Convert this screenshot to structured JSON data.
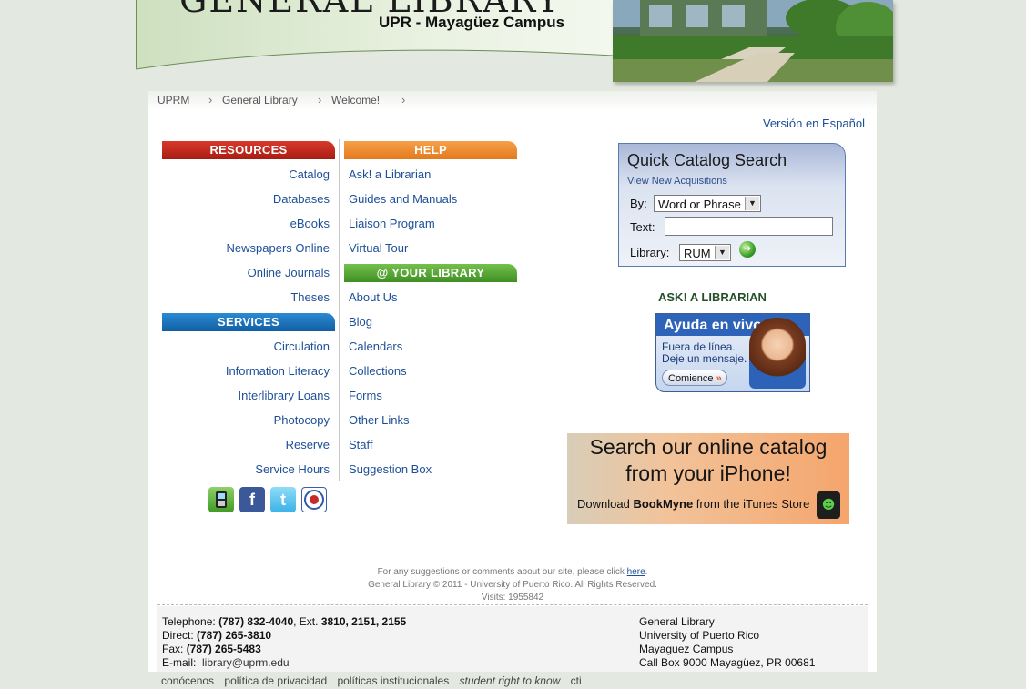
{
  "header": {
    "title_partial": "GENERAL LIBRARY",
    "subtitle": "UPR - Mayagüez Campus"
  },
  "breadcrumb": [
    "UPRM",
    "General Library",
    "Welcome!"
  ],
  "language_link": "Versión en Español",
  "resources": {
    "title": "RESOURCES",
    "items": [
      "Catalog",
      "Databases",
      "eBooks",
      "Newspapers Online",
      "Online Journals",
      "Theses"
    ]
  },
  "services": {
    "title": "SERVICES",
    "items": [
      "Circulation",
      "Information Literacy",
      "Interlibrary Loans",
      "Photocopy",
      "Reserve",
      "Service Hours"
    ]
  },
  "help": {
    "title": "HELP",
    "items": [
      "Ask! a Librarian",
      "Guides and Manuals",
      "Liaison Program",
      "Virtual Tour"
    ]
  },
  "your_library": {
    "title": "@ YOUR LIBRARY",
    "items": [
      "About Us",
      "Blog",
      "Calendars",
      "Collections",
      "Forms",
      "Other Links",
      "Staff",
      "Suggestion Box"
    ]
  },
  "social": [
    "mobile-icon",
    "facebook-icon",
    "twitter-icon",
    "rss-icon"
  ],
  "quick_search": {
    "title": "Quick Catalog Search",
    "new_acquisitions": "View New Acquisitions",
    "by_label": "By:",
    "by_value": "Word or Phrase",
    "text_label": "Text:",
    "text_value": "",
    "library_label": "Library:",
    "library_value": "RUM"
  },
  "ask": {
    "heading": "ASK! A LIBRARIAN",
    "live": "Ayuda en vivo",
    "offline_1": "Fuera de línea.",
    "offline_2": "Deje un mensaje.",
    "start": "Comience"
  },
  "iphone_ad": {
    "line1": "Search our online catalog",
    "line2": "from your iPhone!",
    "download_prefix": "Download ",
    "download_app": "BookMyne",
    "download_suffix": " from the iTunes Store"
  },
  "footer": {
    "suggest_prefix": "For any suggestions or comments about our site, please click ",
    "suggest_link": "here",
    "suggest_suffix": ".",
    "copyright": "General Library © 2011 - University of Puerto Rico. All Rights Reserved.",
    "visits_label": "Visits:",
    "visits_count": "1955842"
  },
  "contact": {
    "telephone_label": "Telephone:",
    "telephone_number": "(787) 832-4040",
    "telephone_ext_label": ", Ext.",
    "telephone_ext": "3810, 2151, 2155",
    "direct_label": "Direct:",
    "direct_number": "(787) 265-3810",
    "fax_label": "Fax:",
    "fax_number": "(787) 265-5483",
    "email_label": "E-mail:",
    "email": "library@uprm.edu",
    "address": [
      "General Library",
      "University of Puerto Rico",
      "Mayaguez Campus",
      "Call Box 9000 Mayagüez, PR 00681"
    ]
  },
  "bottom_links": [
    "conócenos",
    "política de privacidad",
    "políticas institucionales",
    "student right to know",
    "cti"
  ],
  "colors": {
    "resources": "#c02a1e",
    "services": "#1b78c0",
    "help": "#ef8b2c",
    "your_library": "#5aa83a",
    "link": "#1d4f97"
  }
}
